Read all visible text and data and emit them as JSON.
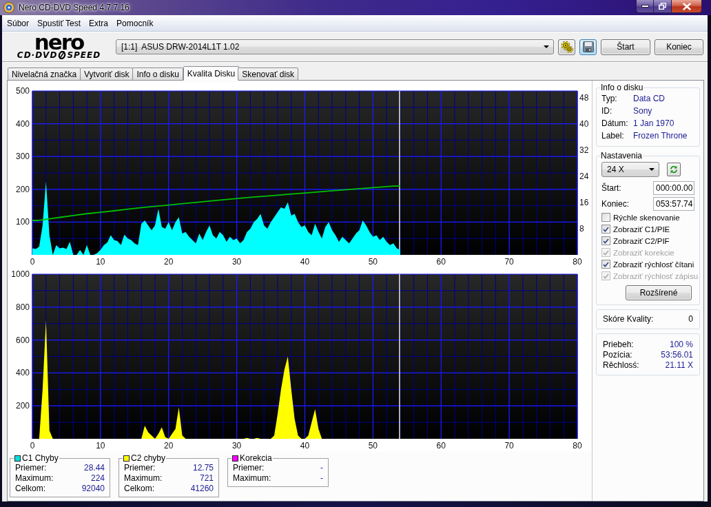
{
  "window": {
    "title": "Nero CD-DVD Speed 4.7.7.16"
  },
  "menu": [
    "Súbor",
    "Spustiť Test",
    "Extra",
    "Pomocník"
  ],
  "logo": {
    "brand": "nero",
    "product_left": "CD·DVD",
    "product_right": "SPEED"
  },
  "toolbar": {
    "drive": "[1:1]  ASUS DRW-2014L1T 1.02",
    "icon_buttons": [
      {
        "kind": "gears",
        "highlighted": false
      },
      {
        "kind": "save",
        "highlighted": true
      }
    ],
    "buttons": [
      "Štart",
      "Koniec"
    ]
  },
  "tabs": [
    {
      "label": "Nivelačná značka",
      "selected": false
    },
    {
      "label": "Vytvoriť disk",
      "selected": false
    },
    {
      "label": "Info o disku",
      "selected": false
    },
    {
      "label": "Kvalita Disku",
      "selected": true
    },
    {
      "label": "Skenovať disk",
      "selected": false
    }
  ],
  "c1_chart": {
    "chart_data": {
      "type": "area",
      "grid": true,
      "xlim": [
        0,
        80
      ],
      "ylim": [
        0,
        500
      ],
      "xticks": [
        0,
        10,
        20,
        30,
        40,
        50,
        60,
        70,
        80
      ],
      "yticks": [
        100,
        200,
        300,
        400,
        500
      ],
      "y2lim": [
        0,
        50
      ],
      "y2ticks": [
        8,
        16,
        24,
        32,
        40,
        48
      ],
      "ref_lines": [
        {
          "axis": "x",
          "value": 53.9,
          "color": "#e8e8e8"
        }
      ],
      "x": [
        0,
        0.5,
        1,
        1.5,
        2,
        2.5,
        3,
        3.5,
        4,
        4.5,
        5,
        5.5,
        6,
        6.5,
        7,
        7.5,
        8,
        8.5,
        9,
        9.5,
        10,
        10.5,
        11,
        11.5,
        12,
        12.5,
        13,
        13.5,
        14,
        14.5,
        15,
        15.5,
        16,
        16.5,
        17,
        17.5,
        18,
        18.5,
        19,
        19.5,
        20,
        20.5,
        21,
        21.5,
        22,
        22.5,
        23,
        23.5,
        24,
        24.5,
        25,
        25.5,
        26,
        26.5,
        27,
        27.5,
        28,
        28.5,
        29,
        29.5,
        30,
        30.5,
        31,
        31.5,
        32,
        32.5,
        33,
        33.5,
        34,
        34.5,
        35,
        35.5,
        36,
        36.5,
        37,
        37.5,
        38,
        38.5,
        39,
        39.5,
        40,
        40.5,
        41,
        41.5,
        42,
        42.5,
        43,
        43.5,
        44,
        44.5,
        45,
        45.5,
        46,
        46.5,
        47,
        47.5,
        48,
        48.5,
        49,
        49.5,
        50,
        50.5,
        51,
        51.5,
        52,
        52.5,
        53,
        53.5,
        54
      ],
      "series": [
        {
          "color": "#00ffff",
          "values": [
            20,
            18,
            25,
            90,
            224,
            60,
            0,
            30,
            20,
            22,
            18,
            40,
            0,
            0,
            15,
            0,
            30,
            0,
            0,
            5,
            15,
            30,
            38,
            60,
            45,
            42,
            30,
            62,
            50,
            45,
            35,
            30,
            95,
            105,
            90,
            75,
            90,
            140,
            85,
            80,
            100,
            75,
            100,
            115,
            65,
            70,
            55,
            45,
            35,
            65,
            45,
            70,
            90,
            60,
            50,
            70,
            60,
            40,
            55,
            45,
            50,
            35,
            45,
            70,
            80,
            100,
            110,
            125,
            90,
            80,
            100,
            115,
            130,
            145,
            140,
            160,
            120,
            125,
            100,
            85,
            90,
            70,
            60,
            95,
            70,
            50,
            85,
            100,
            75,
            60,
            40,
            55,
            45,
            35,
            50,
            65,
            75,
            105,
            90,
            70,
            55,
            60,
            45,
            55,
            40,
            30,
            35,
            20,
            15
          ]
        },
        {
          "type": "line",
          "color": "#00c000",
          "axis": "y2",
          "values": [
            10.5,
            10.5,
            10.5,
            10.5,
            11,
            11,
            11,
            11.5,
            11.5,
            11.5,
            11.5,
            12,
            12,
            12,
            12.5,
            12.5,
            12.5,
            12.5,
            13,
            13,
            13,
            13,
            13,
            13.5,
            13.5,
            13.5,
            13.5,
            14,
            14,
            14,
            14,
            14.5,
            14.5,
            14.5,
            14.5,
            14.5,
            15,
            15,
            15,
            15,
            15,
            15.5,
            15.5,
            15.5,
            15.5,
            15.5,
            16,
            16,
            16,
            16,
            16,
            16.5,
            16.5,
            16.5,
            16.5,
            16.5,
            17,
            17,
            17,
            17,
            17,
            17.5,
            17.5,
            17.5,
            17.5,
            17.5,
            17.5,
            18,
            18,
            18,
            18,
            18,
            18,
            18.5,
            18.5,
            18.5,
            18.5,
            18.5,
            18.5,
            19,
            19,
            19,
            19,
            19,
            19,
            19.5,
            19.5,
            19.5,
            19.5,
            19.5,
            19.5,
            20,
            20,
            20,
            20,
            20,
            20,
            20.5,
            20.5,
            20.5,
            20.5,
            20.5,
            20.5,
            20.5,
            21,
            21,
            21,
            21,
            21
          ]
        }
      ]
    }
  },
  "c2_chart": {
    "chart_data": {
      "type": "area",
      "grid": true,
      "xlim": [
        0,
        80
      ],
      "ylim": [
        0,
        1000
      ],
      "xticks": [
        0,
        10,
        20,
        30,
        40,
        50,
        60,
        70,
        80
      ],
      "yticks": [
        200,
        400,
        600,
        800,
        1000
      ],
      "ref_lines": [
        {
          "axis": "x",
          "value": 53.9,
          "color": "#e8e8e8"
        }
      ],
      "x": [
        0,
        0.5,
        1,
        1.5,
        2,
        2.5,
        3,
        3.5,
        4,
        4.5,
        5,
        5.5,
        6,
        6.5,
        7,
        7.5,
        8,
        8.5,
        9,
        9.5,
        10,
        10.5,
        11,
        11.5,
        12,
        12.5,
        13,
        13.5,
        14,
        14.5,
        15,
        15.5,
        16,
        16.5,
        17,
        17.5,
        18,
        18.5,
        19,
        19.5,
        20,
        20.5,
        21,
        21.5,
        22,
        22.5,
        23,
        23.5,
        24,
        24.5,
        25,
        25.5,
        26,
        26.5,
        27,
        27.5,
        28,
        28.5,
        29,
        29.5,
        30,
        30.5,
        31,
        31.5,
        32,
        32.5,
        33,
        33.5,
        34,
        34.5,
        35,
        35.5,
        36,
        36.5,
        37,
        37.5,
        38,
        38.5,
        39,
        39.5,
        40,
        40.5,
        41,
        41.5,
        42,
        42.5,
        43,
        43.5,
        44,
        44.5,
        45,
        45.5,
        46,
        46.5,
        47,
        47.5,
        48,
        48.5,
        49,
        49.5,
        50,
        50.5,
        51,
        51.5,
        52,
        52.5,
        53,
        53.5,
        54
      ],
      "series": [
        {
          "color": "#ffff00",
          "values": [
            0,
            0,
            0,
            300,
            720,
            50,
            0,
            0,
            0,
            0,
            0,
            0,
            0,
            0,
            0,
            0,
            0,
            0,
            0,
            0,
            0,
            0,
            0,
            0,
            0,
            0,
            0,
            0,
            0,
            0,
            0,
            0,
            0,
            80,
            40,
            20,
            0,
            30,
            70,
            10,
            0,
            30,
            60,
            190,
            20,
            0,
            0,
            0,
            0,
            0,
            0,
            0,
            0,
            0,
            0,
            0,
            0,
            0,
            0,
            0,
            0,
            0,
            0,
            5,
            0,
            0,
            5,
            0,
            0,
            0,
            0,
            20,
            150,
            300,
            420,
            500,
            300,
            120,
            20,
            0,
            0,
            20,
            100,
            180,
            60,
            0,
            0,
            0,
            0,
            0,
            0,
            0,
            0,
            0,
            0,
            0,
            0,
            0,
            0,
            0,
            0,
            0,
            0,
            0,
            0,
            0,
            0,
            0,
            0
          ]
        }
      ]
    }
  },
  "stats": [
    {
      "title": "C1 Chyby",
      "color": "#00e0e0",
      "rows": [
        {
          "label": "Priemer:",
          "value": "28.44"
        },
        {
          "label": "Maximum:",
          "value": "224"
        },
        {
          "label": "Celkom:",
          "value": "92040"
        }
      ]
    },
    {
      "title": "C2 chyby",
      "color": "#ffff00",
      "rows": [
        {
          "label": "Priemer:",
          "value": "12.75"
        },
        {
          "label": "Maximum:",
          "value": "721"
        },
        {
          "label": "Celkom:",
          "value": "41260"
        }
      ]
    },
    {
      "title": "Korekcia",
      "color": "#ff00ff",
      "rows": [
        {
          "label": "Priemer:",
          "value": "-"
        },
        {
          "label": "Maximum:",
          "value": "-"
        }
      ]
    }
  ],
  "disc_info": {
    "title": "Info o disku",
    "rows": [
      {
        "label": "Typ:",
        "value": "Data CD"
      },
      {
        "label": "ID:",
        "value": "Sony"
      },
      {
        "label": "Dátum:",
        "value": "1 Jan 1970"
      },
      {
        "label": "Label:",
        "value": "Frozen Throne"
      }
    ]
  },
  "settings": {
    "title": "Nastavenia",
    "speed": "24 X",
    "start": {
      "label": "Štart:",
      "value": "000:00.00"
    },
    "end": {
      "label": "Koniec:",
      "value": "053:57.74"
    },
    "options": [
      {
        "label": "Rýchle skenovanie",
        "checked": false,
        "disabled": false
      },
      {
        "label": "Zobraziť C1/PIE",
        "checked": true,
        "disabled": false
      },
      {
        "label": "Zobraziť C2/PIF",
        "checked": true,
        "disabled": false
      },
      {
        "label": "Zobraziť korekcie",
        "checked": true,
        "disabled": true
      },
      {
        "label": "Zobraziť rýchlosť čítani",
        "checked": true,
        "disabled": false
      },
      {
        "label": "Zobraziť rýchlosť zápisu",
        "checked": true,
        "disabled": true
      }
    ],
    "advanced_button": "Rozšírené"
  },
  "score": {
    "label": "Skóre Kvality:",
    "value": "0"
  },
  "progress": [
    {
      "label": "Priebeh:",
      "value": "100 %"
    },
    {
      "label": "Pozícia:",
      "value": "53:56.01"
    },
    {
      "label": "Rěchlosś:",
      "value": "21.11 X"
    }
  ]
}
